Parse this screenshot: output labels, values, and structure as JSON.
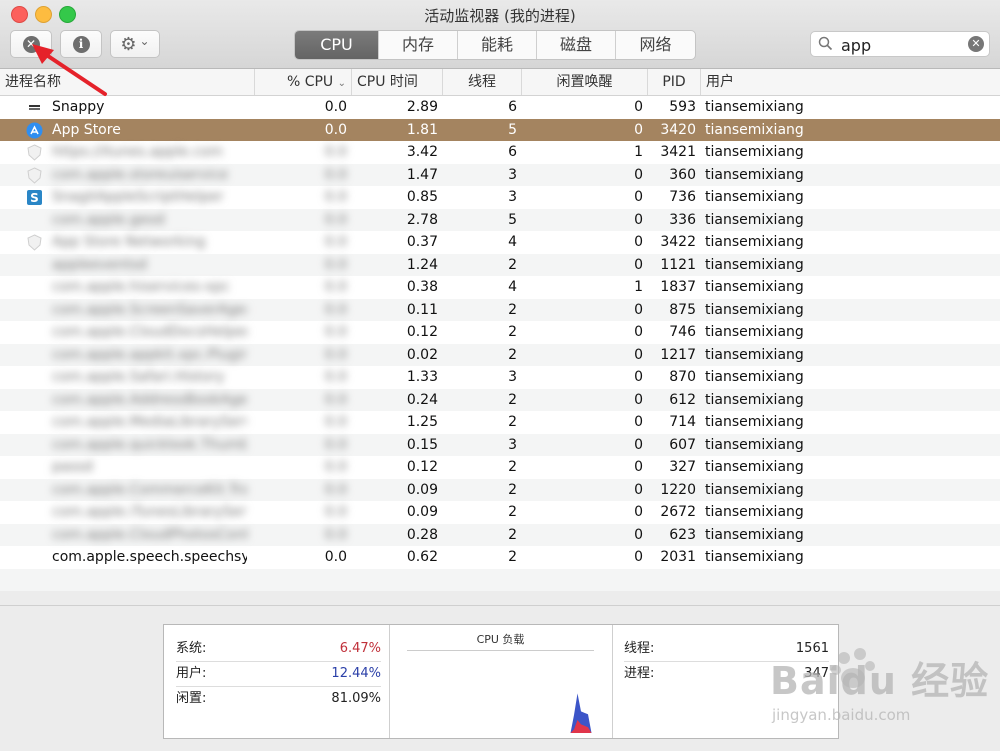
{
  "window": {
    "title": "活动监视器 (我的进程)"
  },
  "toolbar": {
    "stop_glyph": "✕",
    "info_glyph": "i",
    "gear_glyph": "⚙",
    "chevron_glyph": "⌄"
  },
  "tabs": [
    {
      "label": "CPU",
      "active": true
    },
    {
      "label": "内存"
    },
    {
      "label": "能耗"
    },
    {
      "label": "磁盘"
    },
    {
      "label": "网络"
    }
  ],
  "search": {
    "value": "app",
    "icon": "search-icon",
    "clear_glyph": "✕"
  },
  "columns": {
    "name": "进程名称",
    "cpu": "% CPU",
    "cpu_time": "CPU 时间",
    "threads": "线程",
    "idle_wakeups": "闲置唤醒",
    "pid": "PID",
    "user": "用户"
  },
  "rows": [
    {
      "name": "Snappy",
      "cpu": "0.0",
      "time": "2.89",
      "threads": "6",
      "idle": "0",
      "pid": "593",
      "user": "tiansemixiang",
      "icon": "snappy-icon"
    },
    {
      "name": "App Store",
      "cpu": "0.0",
      "time": "1.81",
      "threads": "5",
      "idle": "0",
      "pid": "3420",
      "user": "tiansemixiang",
      "icon": "app-store-icon",
      "selected": true
    },
    {
      "name": "https://itunes.apple.com",
      "cpu": "0.0",
      "time": "3.42",
      "threads": "6",
      "idle": "1",
      "pid": "3421",
      "user": "tiansemixiang",
      "icon": "shield-icon",
      "blurred": true
    },
    {
      "name": "com.apple.storeuiservice",
      "cpu": "0.0",
      "time": "1.47",
      "threads": "3",
      "idle": "0",
      "pid": "360",
      "user": "tiansemixiang",
      "icon": "shield-icon",
      "blurred": true
    },
    {
      "name": "SnagitAppleScriptHelper",
      "cpu": "0.0",
      "time": "0.85",
      "threads": "3",
      "idle": "0",
      "pid": "736",
      "user": "tiansemixiang",
      "icon": "snagit-icon",
      "blurred": true
    },
    {
      "name": "com.apple.geod",
      "cpu": "0.0",
      "time": "2.78",
      "threads": "5",
      "idle": "0",
      "pid": "336",
      "user": "tiansemixiang",
      "blurred": true
    },
    {
      "name": "App Store Networking",
      "cpu": "0.0",
      "time": "0.37",
      "threads": "4",
      "idle": "0",
      "pid": "3422",
      "user": "tiansemixiang",
      "icon": "shield-icon",
      "blurred": true
    },
    {
      "name": "appleeventsd",
      "cpu": "0.0",
      "time": "1.24",
      "threads": "2",
      "idle": "0",
      "pid": "1121",
      "user": "tiansemixiang",
      "blurred": true
    },
    {
      "name": "com.apple.hiservices-xpc",
      "cpu": "0.0",
      "time": "0.38",
      "threads": "4",
      "idle": "1",
      "pid": "1837",
      "user": "tiansemixiang",
      "blurred": true
    },
    {
      "name": "com.apple.ScreenSaverAgent",
      "cpu": "0.0",
      "time": "0.11",
      "threads": "2",
      "idle": "0",
      "pid": "875",
      "user": "tiansemixiang",
      "blurred": true
    },
    {
      "name": "com.apple.CloudDocsHelper",
      "cpu": "0.0",
      "time": "0.12",
      "threads": "2",
      "idle": "0",
      "pid": "746",
      "user": "tiansemixiang",
      "blurred": true
    },
    {
      "name": "com.apple.appkit.xpc.Plugin",
      "cpu": "0.0",
      "time": "0.02",
      "threads": "2",
      "idle": "0",
      "pid": "1217",
      "user": "tiansemixiang",
      "blurred": true
    },
    {
      "name": "com.apple.Safari.History",
      "cpu": "0.0",
      "time": "1.33",
      "threads": "3",
      "idle": "0",
      "pid": "870",
      "user": "tiansemixiang",
      "blurred": true
    },
    {
      "name": "com.apple.AddressBookAgent",
      "cpu": "0.0",
      "time": "0.24",
      "threads": "2",
      "idle": "0",
      "pid": "612",
      "user": "tiansemixiang",
      "blurred": true
    },
    {
      "name": "com.apple.MediaLibraryService",
      "cpu": "0.0",
      "time": "1.25",
      "threads": "2",
      "idle": "0",
      "pid": "714",
      "user": "tiansemixiang",
      "blurred": true
    },
    {
      "name": "com.apple.quicklook.ThumbnailAgent",
      "cpu": "0.0",
      "time": "0.15",
      "threads": "3",
      "idle": "0",
      "pid": "607",
      "user": "tiansemixiang",
      "blurred": true
    },
    {
      "name": "passd",
      "cpu": "0.0",
      "time": "0.12",
      "threads": "2",
      "idle": "0",
      "pid": "327",
      "user": "tiansemixiang",
      "blurred": true
    },
    {
      "name": "com.apple.CommerceKit.TransactionService",
      "cpu": "0.0",
      "time": "0.09",
      "threads": "2",
      "idle": "0",
      "pid": "1220",
      "user": "tiansemixiang",
      "blurred": true
    },
    {
      "name": "com.apple.iTunesLibraryService",
      "cpu": "0.0",
      "time": "0.09",
      "threads": "2",
      "idle": "0",
      "pid": "2672",
      "user": "tiansemixiang",
      "blurred": true
    },
    {
      "name": "com.apple.CloudPhotosConfiguration",
      "cpu": "0.0",
      "time": "0.28",
      "threads": "2",
      "idle": "0",
      "pid": "623",
      "user": "tiansemixiang",
      "blurred": true
    },
    {
      "name": "com.apple.speech.speechsy...",
      "cpu": "0.0",
      "time": "0.62",
      "threads": "2",
      "idle": "0",
      "pid": "2031",
      "user": "tiansemixiang"
    }
  ],
  "stats": {
    "system_label": "系统:",
    "system_value": "6.47%",
    "system_color": "#c0303a",
    "user_label": "用户:",
    "user_value": "12.44%",
    "user_color": "#2a3fa8",
    "idle_label": "闲置:",
    "idle_value": "81.09%",
    "graph_title": "CPU 负载",
    "threads_label": "线程:",
    "threads_value": "1561",
    "processes_label": "进程:",
    "processes_value": "347"
  },
  "cpu_load_graph": {
    "system": [
      0.0,
      0.0,
      0.05,
      0.18,
      0.12,
      0.1,
      0.08,
      0.0
    ],
    "user": [
      0.0,
      0.0,
      0.25,
      0.55,
      0.3,
      0.28,
      0.26,
      0.0
    ],
    "system_color": "#e0354a",
    "user_color": "#3c55c8"
  },
  "watermark": {
    "logo": "Baidu 经验",
    "url": "jingyan.baidu.com"
  },
  "annotation": {
    "arrow_color": "#e5222a"
  },
  "colors": {
    "selected_row": "#a48460",
    "active_tab": "#6e6e6e"
  }
}
